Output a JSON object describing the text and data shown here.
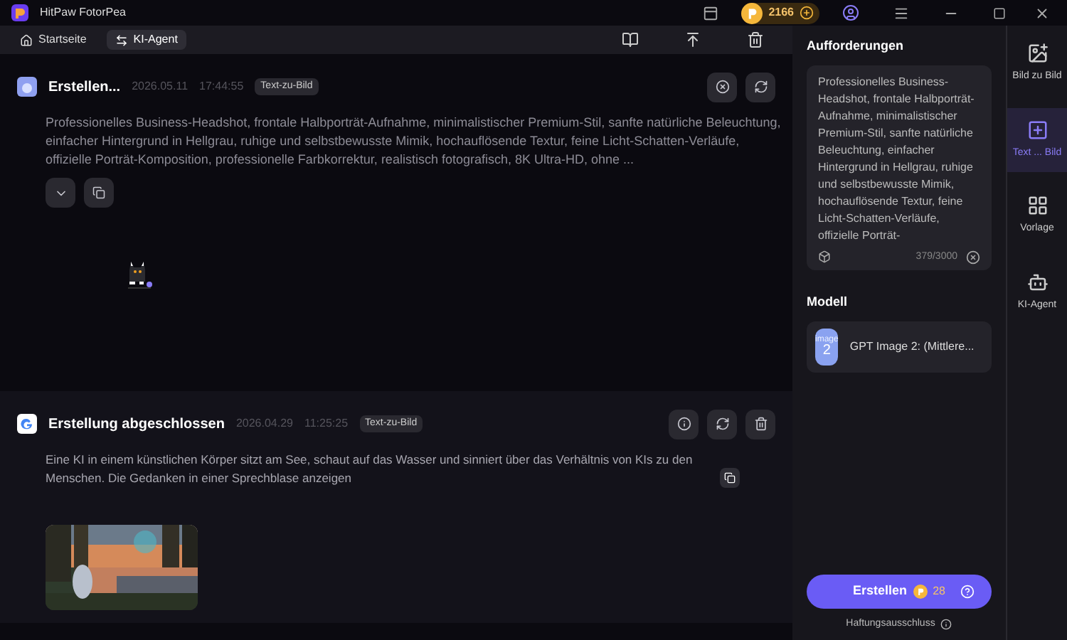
{
  "window": {
    "title": "HitPaw FotorPea",
    "coins": "2166"
  },
  "tabs": [
    {
      "label": "Startseite",
      "selected": false
    },
    {
      "label": "KI-Agent",
      "selected": true
    }
  ],
  "cards": [
    {
      "status": "Erstellen...",
      "date": "2026.05.11",
      "time": "17:44:55",
      "badge": "Text-zu-Bild",
      "prompt": "Professionelles Business-Headshot, frontale Halbporträt-Aufnahme, minimalistischer Premium-Stil, sanfte natürliche Beleuchtung, einfacher Hintergrund in Hellgrau, ruhige und selbstbewusste Mimik, hochauflösende Textur, feine Licht-Schatten-Verläufe, offizielle Porträt-Komposition, professionelle Farbkorrektur, realistisch fotografisch, 8K Ultra-HD, ohne ...",
      "kind": "pending"
    },
    {
      "status": "Erstellung abgeschlossen",
      "date": "2026.04.29",
      "time": "11:25:25",
      "badge": "Text-zu-Bild",
      "prompt": "Eine KI in einem künstlichen Körper sitzt am See, schaut auf das Wasser und sinniert über das Verhältnis von KIs zu den Menschen. Die Gedanken in einer Sprechblase anzeigen",
      "kind": "done"
    }
  ],
  "panel": {
    "prompt_title": "Aufforderungen",
    "prompt": "Professionelles Business-Headshot, frontale Halbporträt-Aufnahme, minimalistischer Premium-Stil, sanfte natürliche Beleuchtung, einfacher Hintergrund in Hellgrau, ruhige und selbstbewusste Mimik, hochauflösende Textur, feine Licht-Schatten-Verläufe, offizielle Porträt-",
    "counter": "379/3000",
    "model_title": "Modell",
    "model_thumb": "image",
    "model_thumb_num": "2",
    "model": "GPT Image 2: (Mittlere...",
    "create": "Erstellen",
    "cost": "28",
    "disclaimer": "Haftungsausschluss"
  },
  "sidebar": [
    {
      "label": "Bild zu Bild",
      "selected": false
    },
    {
      "label": "Text ... Bild",
      "selected": true
    },
    {
      "label": "Vorlage",
      "selected": false
    },
    {
      "label": "KI-Agent",
      "selected": false
    }
  ]
}
